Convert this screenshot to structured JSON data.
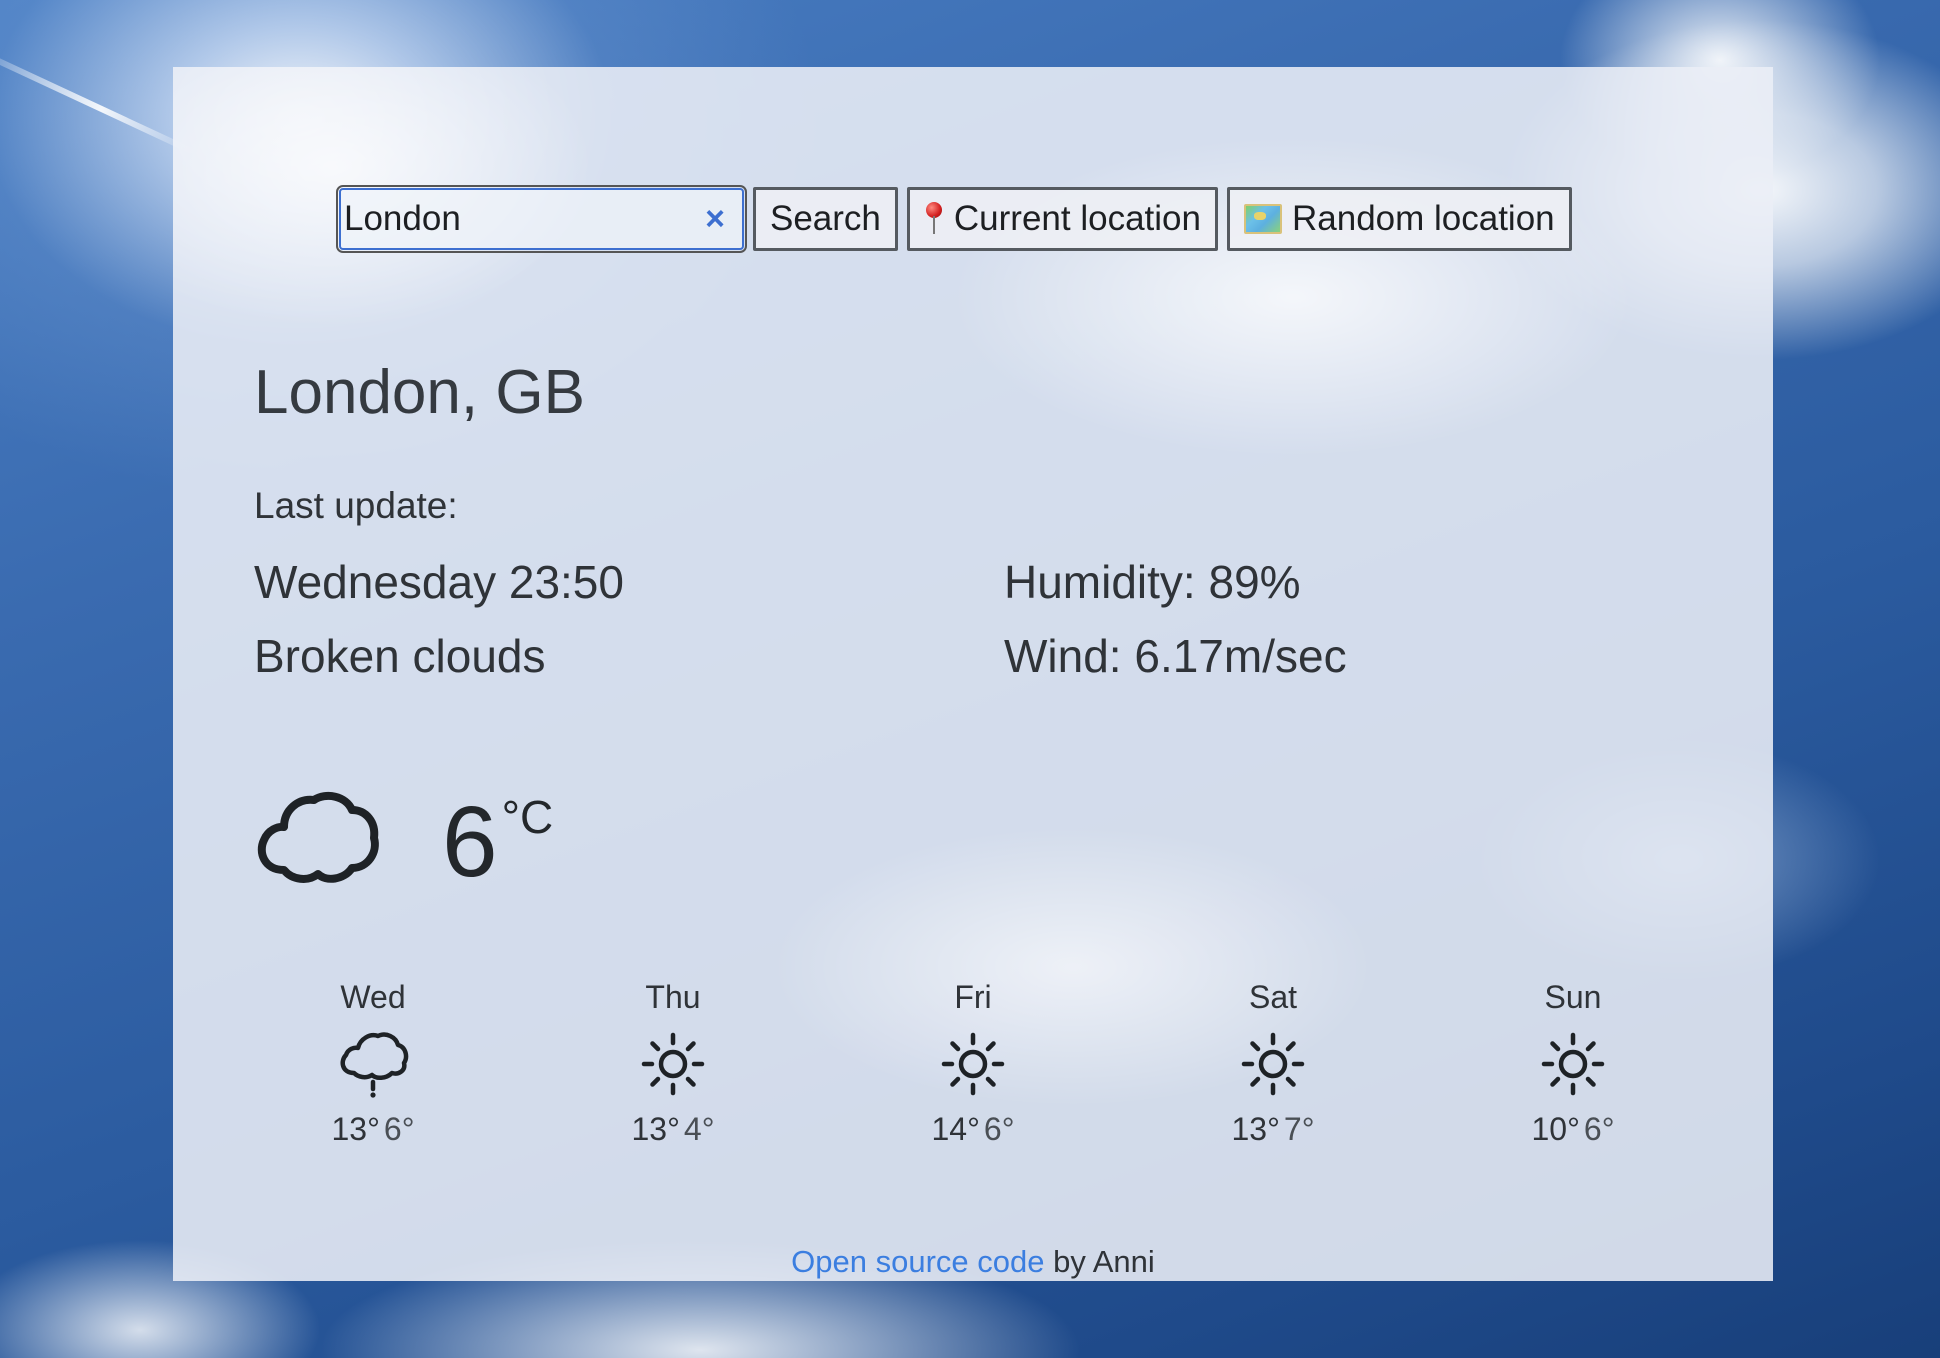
{
  "search": {
    "value": "London",
    "search_button_label": "Search",
    "current_location_label": "Current location",
    "random_location_label": "Random location"
  },
  "current": {
    "city": "London, GB",
    "last_update_label": "Last update:",
    "datetime": "Wednesday 23:50",
    "description": "Broken clouds",
    "humidity": "Humidity: 89%",
    "wind": "Wind: 6.17m/sec",
    "temperature": "6",
    "unit": "°C",
    "icon": "cloud-icon"
  },
  "forecast": [
    {
      "day": "Wed",
      "max": "13°",
      "min": "6°",
      "icon": "rain-cloud-icon"
    },
    {
      "day": "Thu",
      "max": "13°",
      "min": "4°",
      "icon": "sun-icon"
    },
    {
      "day": "Fri",
      "max": "14°",
      "min": "6°",
      "icon": "sun-icon"
    },
    {
      "day": "Sat",
      "max": "13°",
      "min": "7°",
      "icon": "sun-icon"
    },
    {
      "day": "Sun",
      "max": "10°",
      "min": "6°",
      "icon": "sun-icon"
    }
  ],
  "footer": {
    "link_text": "Open source code",
    "suffix": " by Anni"
  },
  "colors": {
    "link": "#3b7ee0",
    "focus_ring": "#3d6fd0"
  }
}
